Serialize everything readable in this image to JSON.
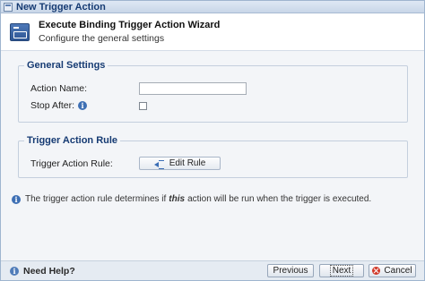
{
  "window": {
    "title": "New Trigger Action"
  },
  "header": {
    "title": "Execute Binding Trigger Action Wizard",
    "subtitle": "Configure the general settings",
    "icon": "wizard-icon"
  },
  "general_settings": {
    "legend": "General Settings",
    "action_name_label": "Action Name:",
    "action_name_value": "",
    "stop_after_label": "Stop After:",
    "stop_after_checked": false
  },
  "trigger_rule": {
    "legend": "Trigger Action Rule",
    "label": "Trigger Action Rule:",
    "edit_button": "Edit Rule"
  },
  "note": {
    "before": "The trigger action rule determines if",
    "emphasis": "this",
    "after": "action will be run when the trigger is executed."
  },
  "footer": {
    "help": "Need Help?",
    "previous": "Previous",
    "next": "Next",
    "cancel": "Cancel"
  },
  "colors": {
    "title_text": "#163b73",
    "border": "#9fb5cf",
    "info": "#3d6fb4",
    "cancel": "#d23a2a"
  }
}
